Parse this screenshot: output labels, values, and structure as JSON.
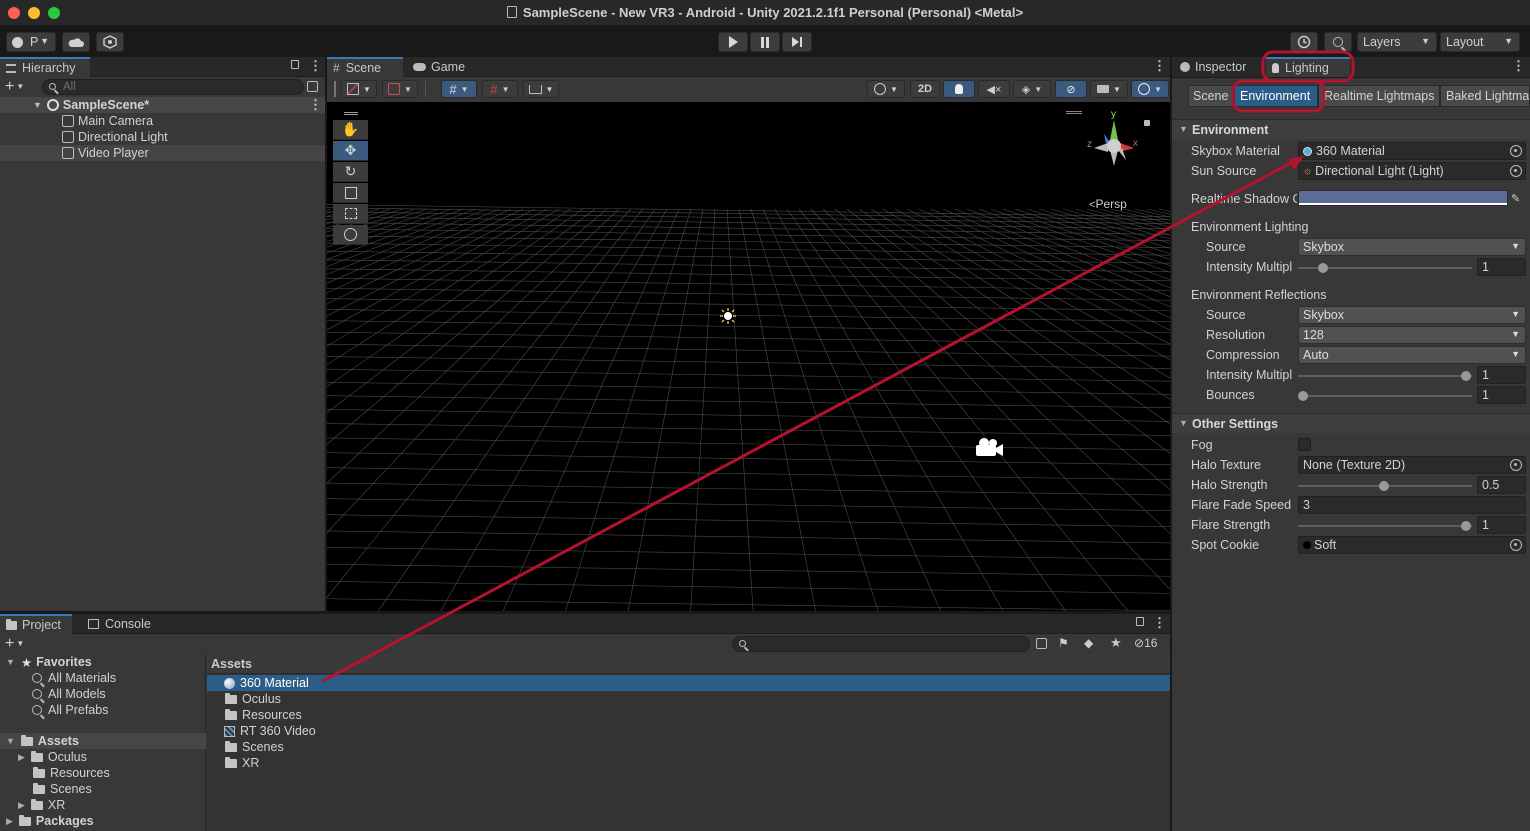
{
  "window": {
    "title": "SampleScene - New VR3 - Android - Unity 2021.2.1f1 Personal (Personal) <Metal>"
  },
  "toolbar": {
    "account_initial": "P",
    "layers_label": "Layers",
    "layout_label": "Layout"
  },
  "hierarchy": {
    "tab_label": "Hierarchy",
    "search_placeholder": "All",
    "scene_name": "SampleScene*",
    "items": [
      "Main Camera",
      "Directional Light",
      "Video Player"
    ]
  },
  "scene_panel": {
    "tab_scene": "Scene",
    "tab_game": "Game",
    "btn_2d": "2D",
    "persp_label": "Persp",
    "axis_y": "y",
    "axis_x": "x",
    "axis_z": "z"
  },
  "inspector": {
    "tab_inspector": "Inspector",
    "tab_lighting": "Lighting",
    "subtabs": [
      "Scene",
      "Environment",
      "Realtime Lightmaps",
      "Baked Lightma"
    ],
    "env_section": "Environment",
    "skybox_label": "Skybox Material",
    "skybox_value": "360 Material",
    "sun_label": "Sun Source",
    "sun_value": "Directional Light (Light)",
    "shadow_label": "Realtime Shadow Color",
    "shadow_color": "#5b6c96",
    "env_lighting_label": "Environment Lighting",
    "env_lighting_source_label": "Source",
    "env_lighting_source_value": "Skybox",
    "env_lighting_intensity_label": "Intensity Multipl",
    "env_lighting_intensity_value": "1",
    "env_reflections_label": "Environment Reflections",
    "refl_source_label": "Source",
    "refl_source_value": "Skybox",
    "refl_resolution_label": "Resolution",
    "refl_resolution_value": "128",
    "refl_compression_label": "Compression",
    "refl_compression_value": "Auto",
    "refl_intensity_label": "Intensity Multipl",
    "refl_intensity_value": "1",
    "refl_bounces_label": "Bounces",
    "refl_bounces_value": "1",
    "other_section": "Other Settings",
    "fog_label": "Fog",
    "halo_texture_label": "Halo Texture",
    "halo_texture_value": "None (Texture 2D)",
    "halo_strength_label": "Halo Strength",
    "halo_strength_value": "0.5",
    "flare_fade_label": "Flare Fade Speed",
    "flare_fade_value": "3",
    "flare_strength_label": "Flare Strength",
    "flare_strength_value": "1",
    "spot_cookie_label": "Spot Cookie",
    "spot_cookie_value": "Soft"
  },
  "project": {
    "tab_project": "Project",
    "tab_console": "Console",
    "hidden_count": "16",
    "favorites_label": "Favorites",
    "favorites": [
      "All Materials",
      "All Models",
      "All Prefabs"
    ],
    "assets_label": "Assets",
    "asset_folders": [
      "Oculus",
      "Resources",
      "Scenes",
      "XR"
    ],
    "packages_label": "Packages",
    "breadcrumb": "Assets",
    "files": [
      "360 Material",
      "Oculus",
      "Resources",
      "RT 360 Video",
      "Scenes",
      "XR"
    ]
  },
  "colors": {
    "accent": "#3a79bb",
    "selection": "#2c5d87",
    "annotation": "#b5122f"
  }
}
